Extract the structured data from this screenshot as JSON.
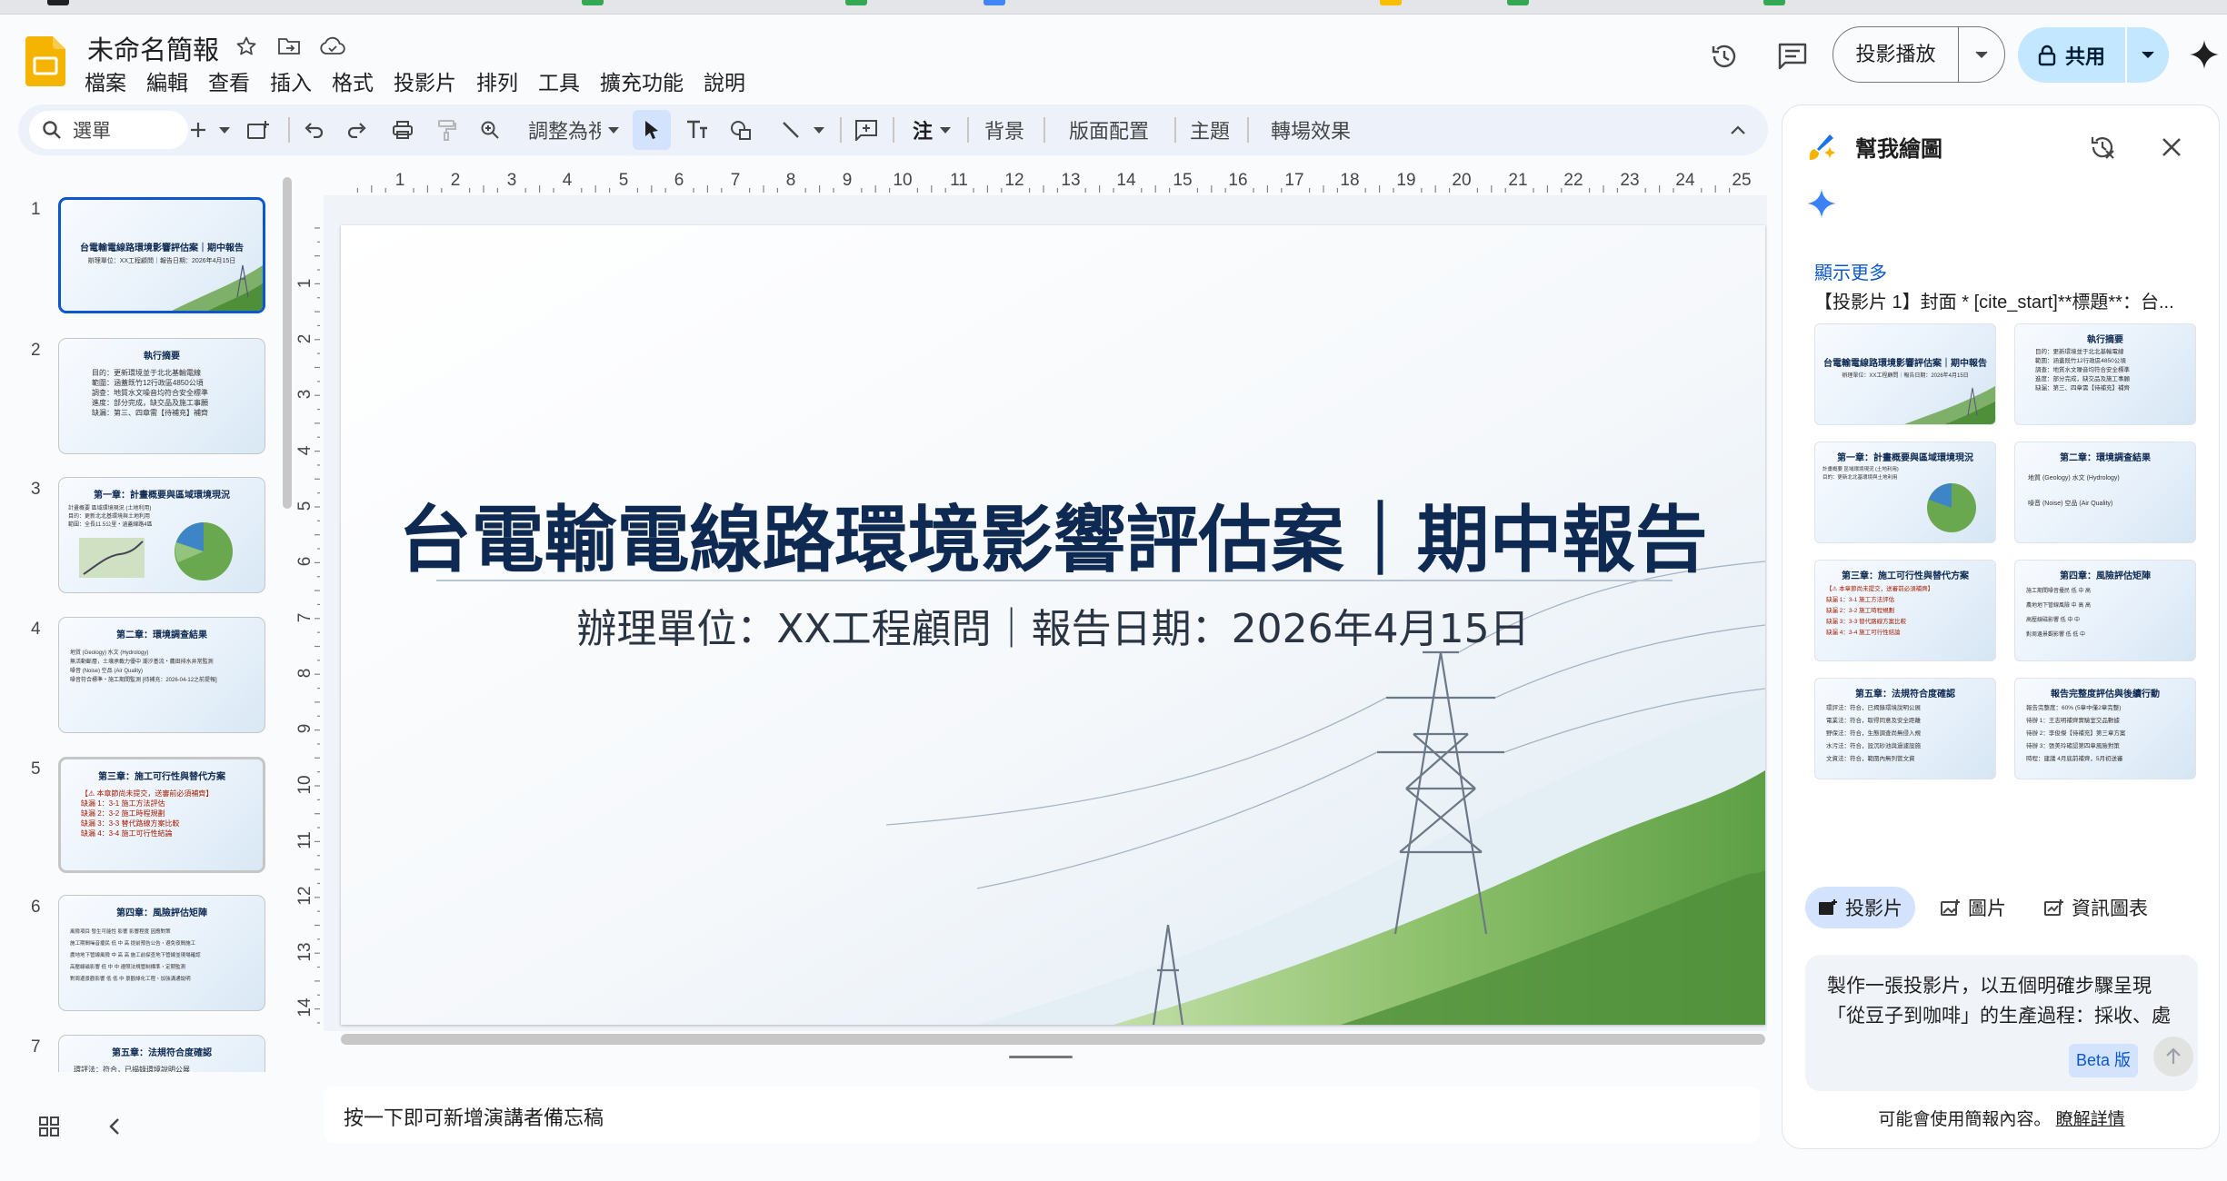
{
  "app": {
    "title": "未命名簡報"
  },
  "menu": [
    "檔案",
    "編輯",
    "查看",
    "插入",
    "格式",
    "投影片",
    "排列",
    "工具",
    "擴充功能",
    "說明"
  ],
  "header": {
    "present_label": "投影播放",
    "share_label": "共用"
  },
  "toolbar": {
    "search_placeholder": "選單",
    "zoom_label": "調整為視",
    "annotate_label": "注",
    "background_label": "背景",
    "layout_label": "版面配置",
    "theme_label": "主題",
    "transition_label": "轉場效果"
  },
  "ruler": {
    "h": [
      "1",
      "2",
      "3",
      "4",
      "5",
      "6",
      "7",
      "8",
      "9",
      "10",
      "11",
      "12",
      "13",
      "14",
      "15",
      "16",
      "17",
      "18",
      "19",
      "20",
      "21",
      "22",
      "23",
      "24",
      "25"
    ],
    "v": [
      "1",
      "2",
      "3",
      "4",
      "5",
      "6",
      "7",
      "8",
      "9",
      "10",
      "11",
      "12",
      "13",
      "14"
    ]
  },
  "filmstrip": {
    "numbers": [
      "1",
      "2",
      "3",
      "4",
      "5",
      "6",
      "7"
    ],
    "slides": [
      {
        "title": "台電輸電線路環境影響評估案｜期中報告",
        "body": "辦理單位：XX工程顧問｜報告日期：2026年4月15日"
      },
      {
        "title": "執行摘要",
        "body": "目的：更新環境並于北北基輸電線\n範圍：涵蓋既竹12行政區4850公頃\n調查：地質水文噪音均符合安全標準\n進度：部分完成，缺交品及施工事願\n缺漏：第三、四章需【待補充】補齊"
      },
      {
        "title": "第一章：計畫概要與區域環境現況",
        "body": "計畫概要        區域環境現況 (土地利用)\n目的：更新北北基環境與土地利用\n範圍：全長11.5公里・涵蓋線路4區"
      },
      {
        "title": "第二章：環境調查結果",
        "body": "地質 (Geology)      水文 (Hydrology)\n無活動斷層，土壤承載力優中     潮汐基流・農田排水井常監測\n噪音 (Noise)        空品 (Air Quality)\n噪音符合標準・施工期間監測      [待補充：2026-04-12之前提報]"
      },
      {
        "title": "第三章：施工可行性與替代方案",
        "body": "【⚠ 本章節尚未提交，送審前必須補齊】\n缺漏 1：3-1 施工方法評估\n缺漏 2：3-2 施工時程規劃\n缺漏 3：3-3 替代路線方案比較\n缺漏 4：3-4 施工可行性結論"
      },
      {
        "title": "第四章：風險評估矩陣",
        "body": "風險項目      發生可能性  影響  影響程度  因應對策\n施工期間噪音擾民   低  中  高  提前預告公告・避免夜間施工\n農地地下管線風險   中  高  高  施工前探查地下管線並現場確認\n高壓線磁影響     低  中  中  遵照法規管制標準・定期監測\n對周邊景觀影響    低  低  中  景觀綠化工程・加強溝通說明"
      },
      {
        "title": "第五章：法規符合度確認",
        "body": "環評法：符合，已揭錄環境說明公展"
      }
    ]
  },
  "slide": {
    "title": "台電輸電線路環境影響評估案｜期中報告",
    "subtitle": "辦理單位：XX工程顧問｜報告日期：2026年4月15日"
  },
  "notes_placeholder": "按一下即可新增演講者備忘稿",
  "panel": {
    "title": "幫我繪圖",
    "show_more": "顯示更多",
    "prompt_echo": "【投影片 1】封面 * [cite_start]**標題**：台...",
    "thumbs": [
      {
        "title": "台電輸電線路環境影響評估案｜期中報告",
        "body": "辦理單位：XX工程顧問｜報告日期：2026年4月15日"
      },
      {
        "title": "執行摘要",
        "body": "目的：更新環境並于北北基輸電線\n範圍：涵蓋既竹12行政區4850公頃\n調查：地質水文噪音均符合安全標準\n進度：部分完成，缺交品及施工事願\n缺漏：第三、四章需【待補充】補齊"
      },
      {
        "title": "第一章：計畫概要與區域環境現況",
        "body": "計畫概要        區域環境現況 (土地利用)\n目的：更新北北基環境與土地利用"
      },
      {
        "title": "第二章：環境調查結果",
        "body": "地質 (Geology)   水文 (Hydrology)\n噪音 (Noise)    空品 (Air Quality)"
      },
      {
        "title": "第三章：施工可行性與替代方案",
        "body": "【⚠ 本章節尚未提交，送審前必須補齊】\n缺漏 1：3-1 施工方法評估\n缺漏 2：3-2 施工時程規劃\n缺漏 3：3-3 替代路線方案比較\n缺漏 4：3-4 施工可行性結論"
      },
      {
        "title": "第四章：風險評估矩陣",
        "body": "施工期間噪音擾民  低 中 高\n農地地下管線風險  中 高 高\n高壓線磁影響    低 中 中\n對周邊景觀影響   低 低 中"
      },
      {
        "title": "第五章：法規符合度確認",
        "body": "環評法：符合，已揭錄環境說明公展\n電業法：符合，取得同意及安全距離\n野保法：符合，生態調查尚無侵入規\n水污法：符合，設沉砂池與過濾設施\n文資法：符合，範圍內無列管文資"
      },
      {
        "title": "報告完整度評估與後續行動",
        "body": "報告完整度：60% (5章中僅2章完整)\n待辦 1：王志明補齊實驗室交品數據\n待辦 2：李俊傑【待補充】第三章方案\n待辦 3：張美玲確認第四章風險對策\n時程：建議 4月底前補齊，5月初送審"
      }
    ],
    "tabs": [
      "投影片",
      "圖片",
      "資訊圖表"
    ],
    "input_text": "製作一張投影片，以五個明確步驟呈現「從豆子到咖啡」的生產過程：採收、處",
    "beta_label": "Beta 版",
    "footer_text": "可能會使用簡報內容。",
    "footer_link": "瞭解詳情"
  }
}
